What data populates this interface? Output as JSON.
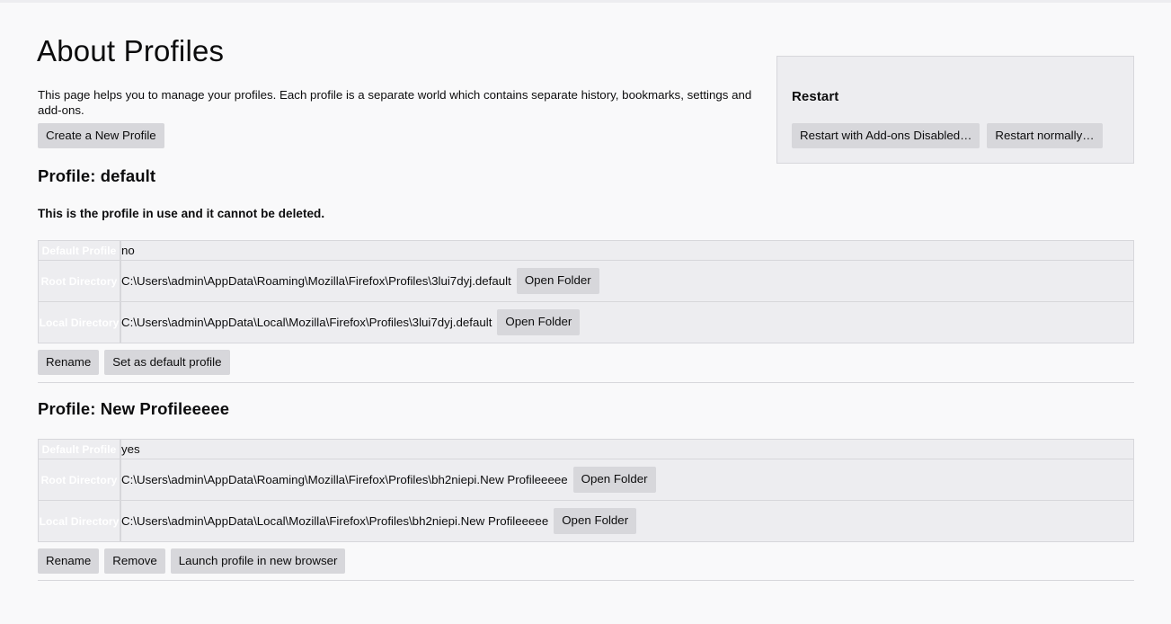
{
  "page": {
    "title": "About Profiles",
    "intro": "This page helps you to manage your profiles. Each profile is a separate world which contains separate history, bookmarks, settings and add-ons.",
    "create_profile_button": "Create a New Profile"
  },
  "restart": {
    "title": "Restart",
    "disabled_addons_button": "Restart with Add-ons Disabled…",
    "normal_button": "Restart normally…"
  },
  "labels": {
    "default_profile": "Default Profile",
    "root_directory": "Root Directory",
    "local_directory": "Local Directory",
    "open_folder": "Open Folder"
  },
  "profiles": [
    {
      "heading": "Profile: default",
      "note": "This is the profile in use and it cannot be deleted.",
      "default_profile": "no",
      "root_directory": "C:\\Users\\admin\\AppData\\Roaming\\Mozilla\\Firefox\\Profiles\\3lui7dyj.default",
      "local_directory": "C:\\Users\\admin\\AppData\\Local\\Mozilla\\Firefox\\Profiles\\3lui7dyj.default",
      "buttons": [
        "Rename",
        "Set as default profile"
      ]
    },
    {
      "heading": "Profile: New Profileeeee",
      "note": "",
      "default_profile": "yes",
      "root_directory": "C:\\Users\\admin\\AppData\\Roaming\\Mozilla\\Firefox\\Profiles\\bh2niepi.New Profileeeee",
      "local_directory": "C:\\Users\\admin\\AppData\\Local\\Mozilla\\Firefox\\Profiles\\bh2niepi.New Profileeeee",
      "buttons": [
        "Rename",
        "Remove",
        "Launch profile in new browser"
      ]
    }
  ],
  "colors": {
    "accent_blue": "#0a84ff",
    "page_background": "#f9f9fa",
    "panel_background": "#ededf0",
    "border": "#d7d7db",
    "button_background": "#d7d7db"
  }
}
